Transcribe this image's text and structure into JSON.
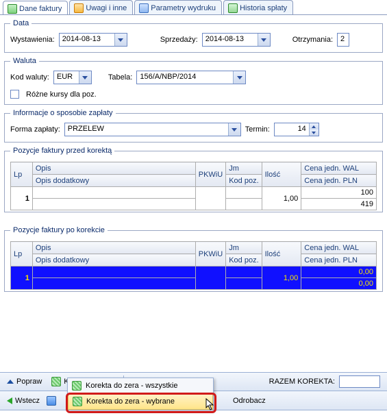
{
  "tabs": {
    "t0": "Dane faktury",
    "t1": "Uwagi i inne",
    "t2": "Parametry wydruku",
    "t3": "Historia spłaty"
  },
  "data_section": {
    "legend": "Data",
    "wystawienia_label": "Wystawienia:",
    "wystawienia_value": "2014-08-13",
    "sprzedazy_label": "Sprzedaży:",
    "sprzedazy_value": "2014-08-13",
    "otrzymania_label": "Otrzymania:",
    "otrzymania_value": "2"
  },
  "waluta_section": {
    "legend": "Waluta",
    "kod_label": "Kod waluty:",
    "kod_value": "EUR",
    "tabela_label": "Tabela:",
    "tabela_value": "156/A/NBP/2014",
    "rozne_kursy": "Różne kursy dla poz."
  },
  "platnosc_section": {
    "legend": "Informacje o sposobie zapłaty",
    "forma_label": "Forma zapłaty:",
    "forma_value": "PRZELEW",
    "termin_label": "Termin:",
    "termin_value": "14"
  },
  "grid_przed": {
    "legend": "Pozycje faktury przed korektą",
    "headers": {
      "lp": "Lp",
      "opis": "Opis",
      "pkwiu": "PKWiU",
      "jm": "Jm",
      "ilosc": "Ilość",
      "cena_wal": "Cena jedn. WAL",
      "opis_dod": "Opis dodatkowy",
      "kod_poz": "Kod poz.",
      "cena_pln": "Cena jedn. PLN"
    },
    "rows": [
      {
        "lp": "1",
        "ilosc": "1,00",
        "cena_wal": "100",
        "cena_pln": "419"
      }
    ]
  },
  "grid_po": {
    "legend": "Pozycje faktury po korekcie",
    "headers": {
      "lp": "Lp",
      "opis": "Opis",
      "pkwiu": "PKWiU",
      "jm": "Jm",
      "ilosc": "Ilość",
      "cena_wal": "Cena jedn. WAL",
      "opis_dod": "Opis dodatkowy",
      "kod_poz": "Kod poz.",
      "cena_pln": "Cena jedn. PLN"
    },
    "rows": [
      {
        "lp": "1",
        "ilosc": "1,00",
        "cena_wal": "0,00",
        "cena_pln": "0,00"
      }
    ]
  },
  "toolbar": {
    "popraw": "Popraw",
    "korekta_btn": "Korekta o...",
    "razem_label": "RAZEM KOREKTA:",
    "wstecz": "Wstecz",
    "odrobacz": "Odrobacz"
  },
  "menu": {
    "item0": "Korekta do zera - wszystkie",
    "item1": "Korekta do zera - wybrane"
  }
}
